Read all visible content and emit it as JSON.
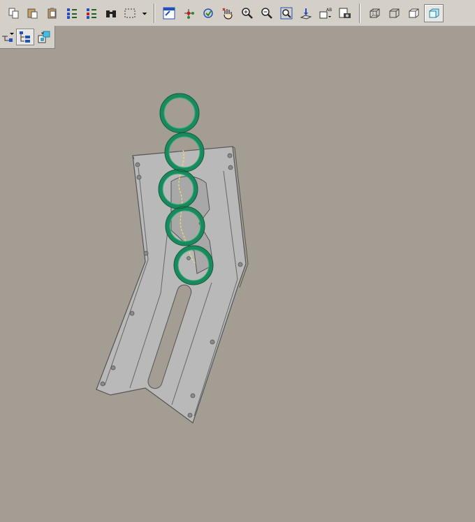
{
  "toolbar": {
    "row1": [
      {
        "name": "copy-icon"
      },
      {
        "name": "paste-icon"
      },
      {
        "name": "paste-special-icon"
      },
      {
        "name": "reorder-tree-icon"
      },
      {
        "name": "reorder-tree-alt-icon"
      },
      {
        "name": "binoculars-search-icon"
      },
      {
        "name": "selection-box-icon"
      },
      {
        "name": "dropdown-arrow-icon"
      },
      {
        "name": "fit-all-icon"
      },
      {
        "name": "connect-nodes-icon"
      },
      {
        "name": "fly-mode-icon"
      },
      {
        "name": "pan-hand-icon"
      },
      {
        "name": "zoom-in-icon"
      },
      {
        "name": "zoom-out-icon"
      },
      {
        "name": "zoom-area-icon"
      },
      {
        "name": "normal-view-icon"
      },
      {
        "name": "create-multi-view-icon"
      },
      {
        "name": "capture-image-icon"
      },
      {
        "name": "wireframe-cube-icon"
      },
      {
        "name": "hidden-edges-cube-icon"
      },
      {
        "name": "outline-cube-icon"
      },
      {
        "name": "shaded-cube-icon"
      }
    ],
    "row2": [
      {
        "name": "tree-expand-icon"
      },
      {
        "name": "tree-structure-icon"
      },
      {
        "name": "swap-visible-space-icon"
      }
    ],
    "colors": {
      "toolbar_bg": "#d4d0c8",
      "viewport_bg": "#a49d93",
      "part_fill": "#b9b9b9",
      "ring_color": "#1a8a5e"
    }
  }
}
